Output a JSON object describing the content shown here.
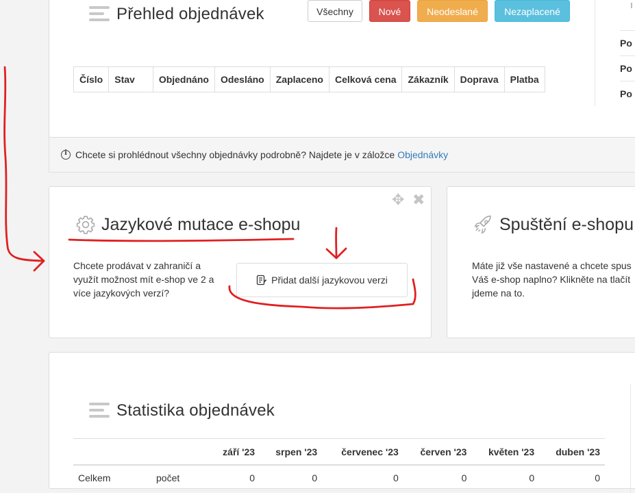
{
  "orders": {
    "title": "Přehled objednávek",
    "filters": [
      "Všechny",
      "Nové",
      "Neodeslané",
      "Nezaplacené"
    ],
    "columns": [
      "Číslo",
      "Stav",
      "Objednáno",
      "Odesláno",
      "Zaplaceno",
      "Celková cena",
      "Zákazník",
      "Doprava",
      "Platba"
    ],
    "side_items": [
      "Po",
      "Po",
      "Po"
    ],
    "info_text": "Chcete si prohlédnout všechny objednávky podrobně? Najdete je v záložce",
    "info_link": "Objednávky"
  },
  "lang": {
    "title": "Jazykové mutace e-shopu",
    "desc": "Chcete prodávat v zahraničí a využít možnost mít e-shop ve 2 a více jazykových verzí?",
    "button": "Přidat další jazykovou verzi"
  },
  "launch": {
    "title": "Spuštění e-shopu",
    "desc_lines": [
      "Máte již vše nastavené a chcete spus",
      "Váš e-shop naplno? Klikněte na tlačít",
      "jdeme na to."
    ]
  },
  "stats": {
    "title": "Statistika objednávek",
    "months": [
      "září '23",
      "srpen '23",
      "červenec '23",
      "červen '23",
      "květen '23",
      "duben '23"
    ],
    "row": {
      "label": "Celkem",
      "sublabel": "počet",
      "values": [
        "0",
        "0",
        "0",
        "0",
        "0",
        "0"
      ]
    }
  },
  "colors": {
    "danger": "#d9534f",
    "warning": "#f0ad4e",
    "info": "#5bc0de",
    "link": "#337ab7",
    "annotation": "#e02020"
  }
}
